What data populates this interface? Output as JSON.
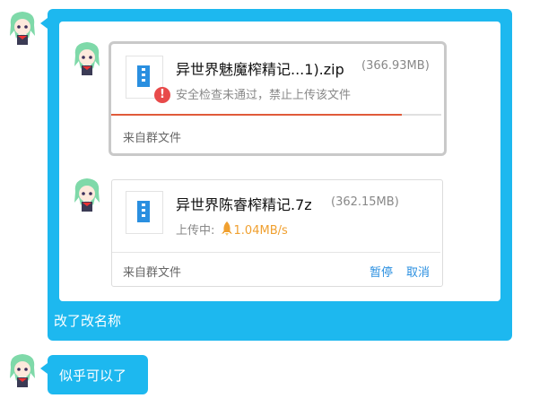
{
  "messages": [
    {
      "caption": "改了改名称",
      "files": [
        {
          "name": "异世界魅魔榨精记...1).zip",
          "size": "(366.93MB)",
          "status_text": "安全检查未通过，禁止上传该文件",
          "status_icon": "error-icon",
          "error_mark": "!",
          "progress": 0.88,
          "progress_color": "#e05a3a",
          "source": "来自群文件",
          "file_icon": "zip-file-icon"
        },
        {
          "name": "异世界陈睿榨精记.7z",
          "size": "(362.15MB)",
          "status_prefix": "上传中:",
          "speed": "1.04MB/s",
          "speed_icon": "rocket-icon",
          "source": "来自群文件",
          "actions": {
            "pause": "暂停",
            "cancel": "取消"
          },
          "file_icon": "zip-file-icon"
        }
      ]
    },
    {
      "text": "似乎可以了"
    }
  ],
  "colors": {
    "bubble": "#1db8ef",
    "link": "#2a8fe0",
    "error": "#e84a4a",
    "speed": "#f0a030"
  }
}
